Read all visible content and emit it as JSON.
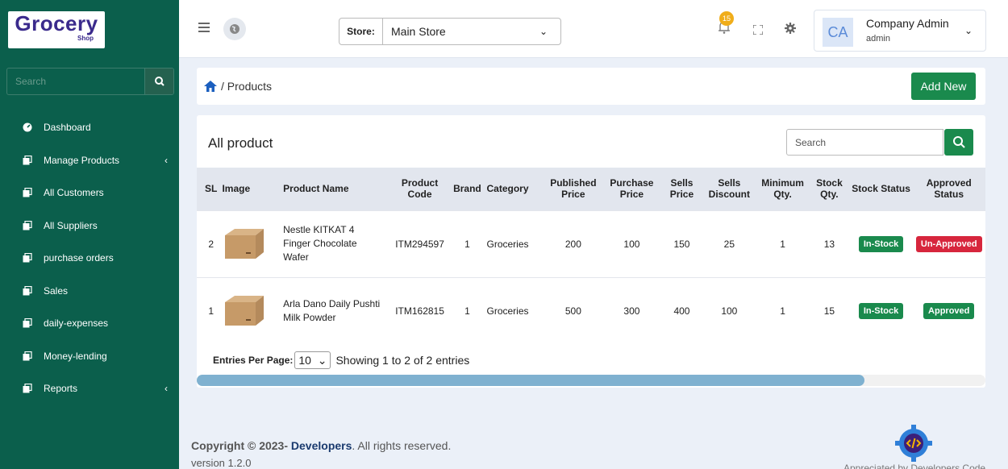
{
  "brand": {
    "name": "Grocery",
    "sub": "Shop"
  },
  "sidebar": {
    "search_placeholder": "Search",
    "items": [
      {
        "label": "Dashboard",
        "icon": "dashboard-icon",
        "has_sub": false
      },
      {
        "label": "Manage Products",
        "icon": "copy-icon",
        "has_sub": true
      },
      {
        "label": "All Customers",
        "icon": "copy-icon",
        "has_sub": false
      },
      {
        "label": "All Suppliers",
        "icon": "copy-icon",
        "has_sub": false
      },
      {
        "label": "purchase orders",
        "icon": "copy-icon",
        "has_sub": false
      },
      {
        "label": "Sales",
        "icon": "copy-icon",
        "has_sub": false
      },
      {
        "label": "daily-expenses",
        "icon": "copy-icon",
        "has_sub": false
      },
      {
        "label": "Money-lending",
        "icon": "copy-icon",
        "has_sub": false
      },
      {
        "label": "Reports",
        "icon": "copy-icon",
        "has_sub": true
      }
    ]
  },
  "topbar": {
    "store_label": "Store:",
    "store_value": "Main Store",
    "notification_count": "15",
    "user": {
      "initials": "CA",
      "name": "Company Admin",
      "role": "admin"
    }
  },
  "breadcrumb": {
    "path": "/ Products",
    "add_label": "Add New"
  },
  "products": {
    "title": "All product",
    "search_placeholder": "Search",
    "columns": [
      "SL",
      "Image",
      "Product Name",
      "Product Code",
      "Brand",
      "Category",
      "Published Price",
      "Purchase Price",
      "Sells Price",
      "Sells Discount",
      "Minimum Qty.",
      "Stock Qty.",
      "Stock Status",
      "Approved Status"
    ],
    "rows": [
      {
        "sl": "2",
        "name": "Nestle KITKAT 4 Finger Chocolate Wafer",
        "code": "ITM294597",
        "brand": "1",
        "category": "Groceries",
        "published": "200",
        "purchase": "100",
        "sells": "150",
        "discount": "25",
        "min_qty": "1",
        "stock_qty": "13",
        "stock_status": "In-Stock",
        "approved": "Un-Approved"
      },
      {
        "sl": "1",
        "name": "Arla Dano Daily Pushti Milk Powder",
        "code": "ITM162815",
        "brand": "1",
        "category": "Groceries",
        "published": "500",
        "purchase": "300",
        "sells": "400",
        "discount": "100",
        "min_qty": "1",
        "stock_qty": "15",
        "stock_status": "In-Stock",
        "approved": "Approved"
      }
    ],
    "entries_label": "Entries Per Page:",
    "entries_value": "10",
    "showing": "Showing 1 to 2 of 2 entries"
  },
  "footer": {
    "copy_prefix": "Copyright © 2023-",
    "copy_brand": "Developers",
    "copy_suffix": ". All rights reserved.",
    "version": "version 1.2.0",
    "dev_text": "Appreciated by Developers Code"
  },
  "colors": {
    "sidebar": "#0b5f4c",
    "accent": "#1a8a4d",
    "danger": "#d7263d",
    "badge": "#f0ad1a"
  }
}
